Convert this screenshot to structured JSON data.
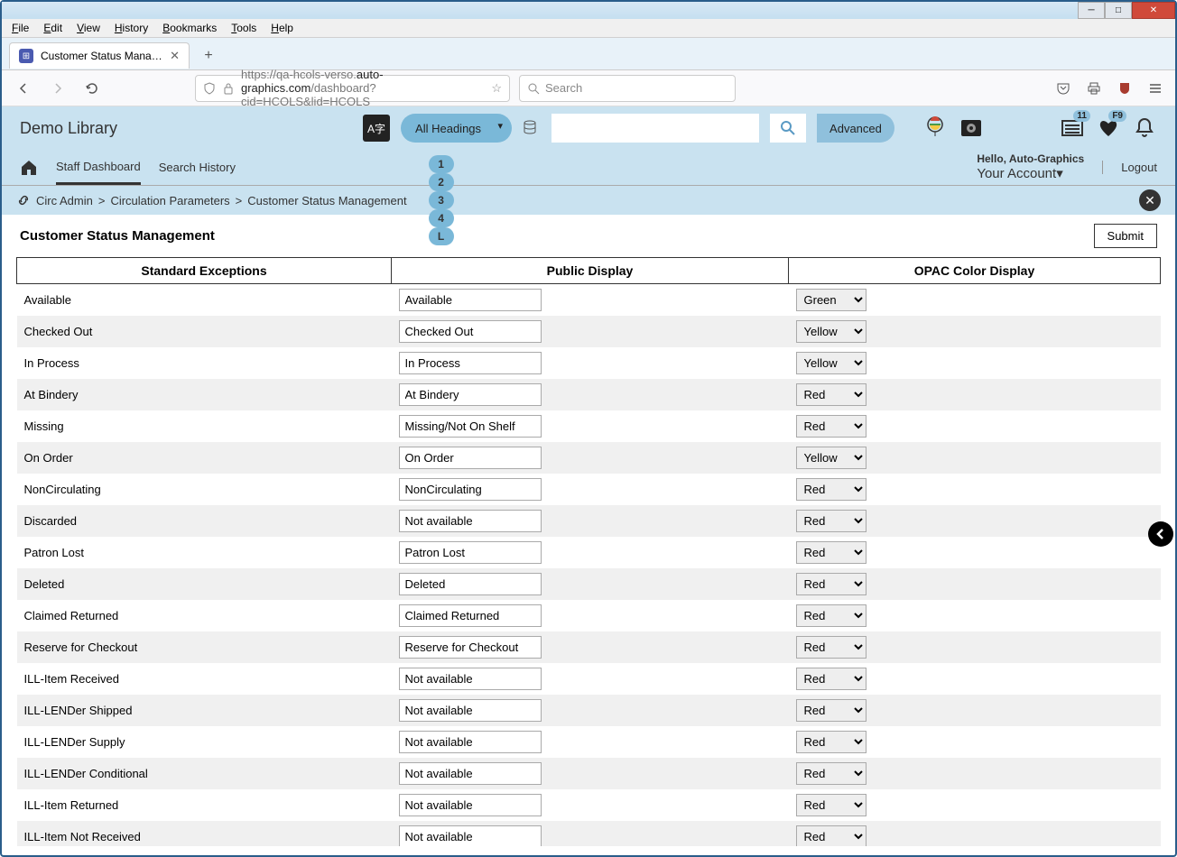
{
  "browser": {
    "menu": [
      "File",
      "Edit",
      "View",
      "History",
      "Bookmarks",
      "Tools",
      "Help"
    ],
    "tab_title": "Customer Status Management",
    "url_pre": "https://qa-hcols-verso.",
    "url_bold": "auto-graphics.com",
    "url_post": "/dashboard?cid=HCOLS&lid=HCOLS",
    "search_placeholder": "Search"
  },
  "header": {
    "brand": "Demo Library",
    "all_headings": "All Headings",
    "advanced": "Advanced",
    "list_badge": "11",
    "heart_badge": "F9"
  },
  "nav": {
    "home_sr": "Home",
    "staff_dashboard": "Staff Dashboard",
    "search_history": "Search History",
    "hello": "Hello, Auto-Graphics",
    "your_account": "Your Account",
    "logout": "Logout"
  },
  "breadcrumb": {
    "admin": "Circ Admin",
    "params": "Circulation Parameters",
    "page": "Customer Status Management",
    "steps": [
      "1",
      "2",
      "3",
      "4",
      "L"
    ]
  },
  "page": {
    "title": "Customer Status Management",
    "submit": "Submit",
    "col1": "Standard Exceptions",
    "col2": "Public Display",
    "col3": "OPAC Color Display"
  },
  "color_options": [
    "Green",
    "Yellow",
    "Red"
  ],
  "rows": [
    {
      "name": "Available",
      "display": "Available",
      "color": "Green"
    },
    {
      "name": "Checked Out",
      "display": "Checked Out",
      "color": "Yellow"
    },
    {
      "name": "In Process",
      "display": "In Process",
      "color": "Yellow"
    },
    {
      "name": "At Bindery",
      "display": "At Bindery",
      "color": "Red"
    },
    {
      "name": "Missing",
      "display": "Missing/Not On Shelf",
      "color": "Red"
    },
    {
      "name": "On Order",
      "display": "On Order",
      "color": "Yellow"
    },
    {
      "name": "NonCirculating",
      "display": "NonCirculating",
      "color": "Red"
    },
    {
      "name": "Discarded",
      "display": "Not available",
      "color": "Red"
    },
    {
      "name": "Patron Lost",
      "display": "Patron Lost",
      "color": "Red"
    },
    {
      "name": "Deleted",
      "display": "Deleted",
      "color": "Red"
    },
    {
      "name": "Claimed Returned",
      "display": "Claimed Returned",
      "color": "Red"
    },
    {
      "name": "Reserve for Checkout",
      "display": "Reserve for Checkout",
      "color": "Red"
    },
    {
      "name": "ILL-Item Received",
      "display": "Not available",
      "color": "Red"
    },
    {
      "name": "ILL-LENDer Shipped",
      "display": "Not available",
      "color": "Red"
    },
    {
      "name": "ILL-LENDer Supply",
      "display": "Not available",
      "color": "Red"
    },
    {
      "name": "ILL-LENDer Conditional",
      "display": "Not available",
      "color": "Red"
    },
    {
      "name": "ILL-Item Returned",
      "display": "Not available",
      "color": "Red"
    },
    {
      "name": "ILL-Item Not Received",
      "display": "Not available",
      "color": "Red"
    }
  ]
}
